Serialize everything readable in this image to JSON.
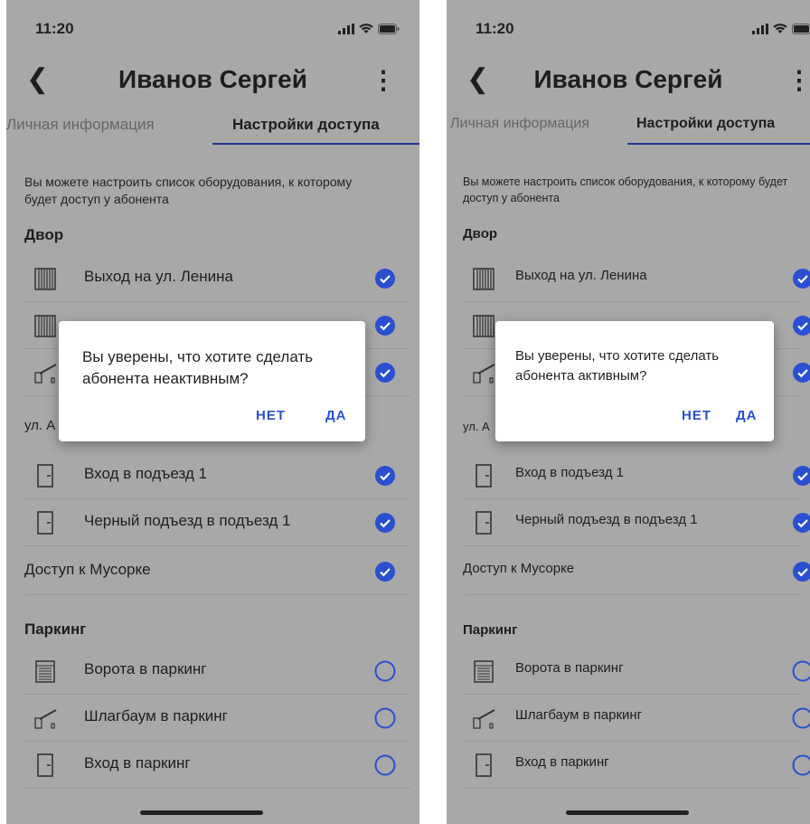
{
  "screens": [
    {
      "status_time": "11:20",
      "title": "Иванов Сергей",
      "tabs": [
        "Личная информация",
        "Настройки доступа"
      ],
      "description": "Вы можете настроить список оборудования, к которому будет доступ у абонента",
      "sections": {
        "yard": "Двор",
        "street": "ул. А",
        "parking": "Паркинг"
      },
      "rows": [
        {
          "label": "Выход на ул. Ленина",
          "checked": true
        },
        {
          "label": "",
          "checked": true
        },
        {
          "label": "",
          "checked": true
        },
        {
          "label": "Вход в подъезд 1",
          "checked": true
        },
        {
          "label": "Черный подъезд в подъезд 1",
          "checked": true
        },
        {
          "label": "Доступ к Мусорке",
          "checked": true
        },
        {
          "label": "Ворота в паркинг",
          "checked": false
        },
        {
          "label": "Шлагбаум в паркинг",
          "checked": false
        },
        {
          "label": "Вход в паркинг",
          "checked": false
        }
      ],
      "dialog": {
        "text": "Вы уверены, что хотите сделать абонента неактивным?",
        "no": "НЕТ",
        "yes": "ДА"
      }
    },
    {
      "status_time": "11:20",
      "title": "Иванов Сергей",
      "tabs": [
        "Личная информация",
        "Настройки доступа"
      ],
      "description": "Вы можете настроить список оборудования, к которому будет доступ у абонента",
      "sections": {
        "yard": "Двор",
        "street": "ул. А",
        "parking": "Паркинг"
      },
      "rows": [
        {
          "label": "Выход на ул. Ленина",
          "checked": true
        },
        {
          "label": "",
          "checked": true
        },
        {
          "label": "",
          "checked": true
        },
        {
          "label": "Вход в подъезд 1",
          "checked": true
        },
        {
          "label": "Черный подъезд в подъезд 1",
          "checked": true
        },
        {
          "label": "Доступ к Мусорке",
          "checked": true
        },
        {
          "label": "Ворота в паркинг",
          "checked": false
        },
        {
          "label": "Шлагбаум в паркинг",
          "checked": false
        },
        {
          "label": "Вход в паркинг",
          "checked": false
        }
      ],
      "dialog": {
        "text": "Вы уверены, что хотите сделать абонента активным?",
        "no": "НЕТ",
        "yes": "ДА"
      }
    }
  ],
  "colors": {
    "accent": "#2d4fd6",
    "check": "#2a4fd0",
    "scrim": "#a8a8a8",
    "tab_underline": "#23359a"
  }
}
